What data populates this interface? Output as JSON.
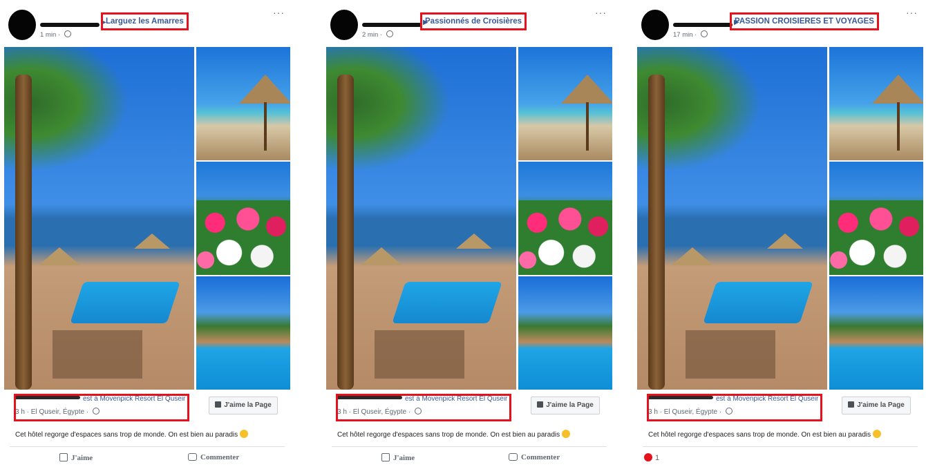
{
  "posts": [
    {
      "group": "Larguez les Amarres",
      "time": "1 min",
      "show_actions": true,
      "reaction_count": ""
    },
    {
      "group": "Passionnés de Croisières",
      "time": "2 min",
      "show_actions": true,
      "reaction_count": ""
    },
    {
      "group": "PASSION CROISIERES ET VOYAGES",
      "time": "17 min",
      "show_actions": false,
      "reaction_count": "1"
    }
  ],
  "shared": {
    "arrow": "▶",
    "at_text": "est à Movenpick Resort El Quseir",
    "location_line": "3 h · El Quseir, Égypte ·",
    "like_page": "J'aime la Page",
    "caption": "Cet hôtel regorge d'espaces sans trop de monde. On est bien au paradis",
    "like_label": "J'aime",
    "comment_label": "Commenter",
    "more": "···"
  },
  "colors": {
    "highlight_box": "#e4121d",
    "link": "#385898"
  },
  "icons": [
    "globe-icon",
    "more-icon",
    "thumb-icon",
    "emoji-icon",
    "like-icon",
    "comment-icon",
    "heart-icon"
  ]
}
